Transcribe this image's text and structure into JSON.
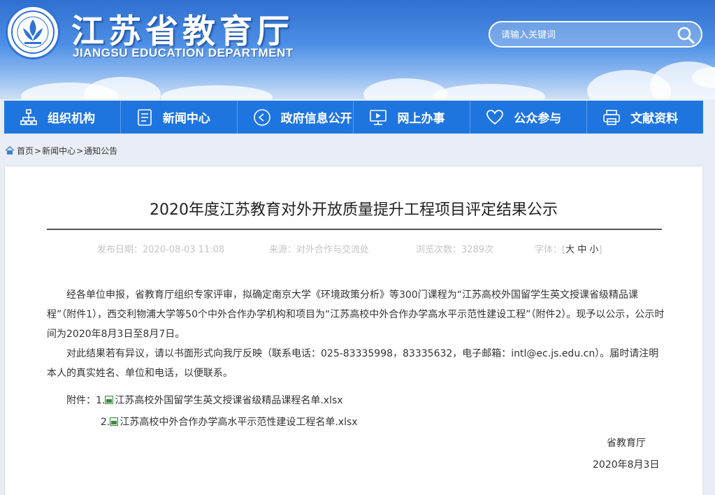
{
  "header": {
    "title": "江苏省教育厅",
    "subtitle": "JIANGSU EDUCATION DEPARTMENT",
    "search_placeholder": "请输入关键词"
  },
  "nav": [
    {
      "label": "组织机构",
      "icon": "org-chart-icon"
    },
    {
      "label": "新闻中心",
      "icon": "document-icon"
    },
    {
      "label": "政府信息公开",
      "icon": "info-open-icon"
    },
    {
      "label": "网上办事",
      "icon": "monitor-icon"
    },
    {
      "label": "公众参与",
      "icon": "heart-icon"
    },
    {
      "label": "文献资料",
      "icon": "printer-icon"
    }
  ],
  "breadcrumb": {
    "home": "首页",
    "sep": ">",
    "level1": "新闻中心",
    "level2": "通知公告"
  },
  "article": {
    "title": "2020年度江苏教育对外开放质量提升工程项目评定结果公示",
    "meta": {
      "date": "发布日期：2020-08-03 11:08",
      "source": "来源：对外合作与交流处",
      "views": "浏览次数：3289次",
      "font_label": "字体：[",
      "font_large": "大",
      "font_medium": "中",
      "font_small": "小",
      "font_close": "]"
    },
    "paragraph1": "经各单位申报，省教育厅组织专家评审，拟确定南京大学《环境政策分析》等300门课程为“江苏高校外国留学生英文授课省级精品课程”（附件1），西交利物浦大学等50个中外合作办学机构和项目为“江苏高校中外合作办学高水平示范性建设工程”（附件2）。现予以公示，公示时间为2020年8月3日至8月7日。",
    "paragraph2": "对此结果若有异议，请以书面形式向我厅反映（联系电话：025-83335998，83335632，电子邮箱：intl@ec.js.edu.cn）。届时请注明本人的真实姓名、单位和电话，以便联系。",
    "attachments_label": "附件：",
    "attachments": [
      {
        "num": "1.",
        "name": "江苏高校外国留学生英文授课省级精品课程名单.xlsx"
      },
      {
        "num": "2.",
        "name": "江苏高校中外合作办学高水平示范性建设工程名单.xlsx"
      }
    ],
    "signature": "省教育厅",
    "sign_date": "2020年8月3日"
  },
  "colors": {
    "nav_bg": "#1e75e0",
    "header_top": "#2f6fd0",
    "accent": "#2f73d6"
  }
}
